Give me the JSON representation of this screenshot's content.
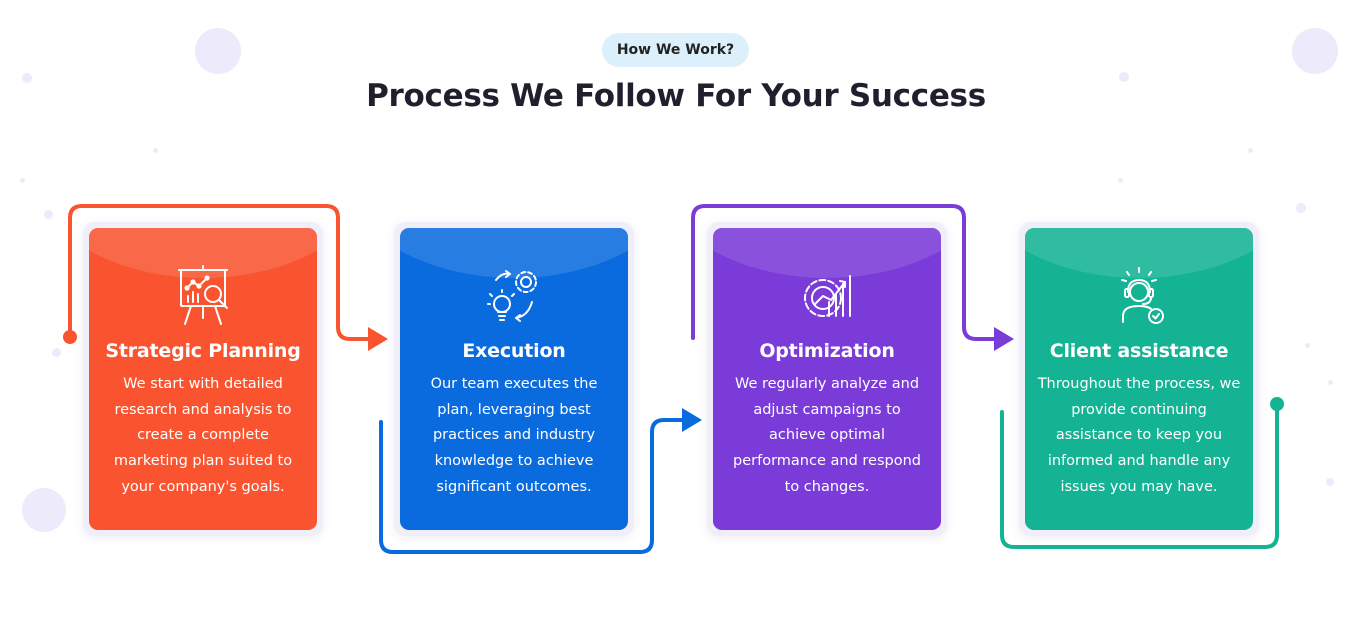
{
  "header": {
    "badge": "How We Work?",
    "title": "Process We Follow For Your Success"
  },
  "colors": {
    "orange": "#f9542f",
    "blue": "#0a6bdf",
    "purple": "#7a3bd8",
    "teal": "#13b394"
  },
  "steps": [
    {
      "icon": "presentation-chart-magnifier-icon",
      "title": "Strategic Planning",
      "text": "We start with detailed research and analysis to create a complete marketing plan suited to your company's goals."
    },
    {
      "icon": "lightbulb-gear-icon",
      "title": "Execution",
      "text": "Our team executes the plan, leveraging best practices and industry knowledge to achieve significant outcomes."
    },
    {
      "icon": "gear-bar-chart-icon",
      "title": "Optimization",
      "text": "We regularly analyze and adjust campaigns to achieve optimal performance and respond to changes."
    },
    {
      "icon": "headset-support-icon",
      "title": "Client assistance",
      "text": "Throughout the process, we provide continuing assistance to keep you informed and handle any issues you may have."
    }
  ]
}
